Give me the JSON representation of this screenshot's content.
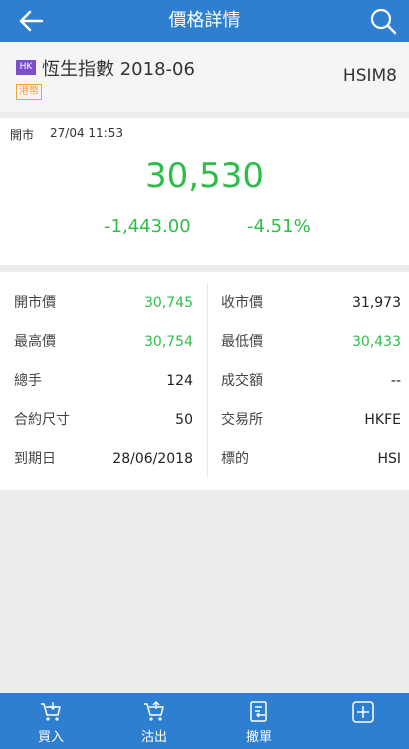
{
  "header": {
    "title": "價格詳情",
    "back_icon": "arrow-left-icon",
    "search_icon": "search-icon"
  },
  "instrument": {
    "market_badge": "HK",
    "name": "恆生指數 2018-06",
    "currency_badge": "港幣",
    "code": "HSIM8"
  },
  "quote": {
    "status": "開市",
    "time": "27/04 11:53",
    "last": "30,530",
    "change": "-1,443.00",
    "change_pct": "-4.51%",
    "up_color": "#2fbd4a"
  },
  "details": [
    {
      "left_label": "開市價",
      "left_value": "30,745",
      "right_label": "收市價",
      "right_value": "31,973"
    },
    {
      "left_label": "最高價",
      "left_value": "30,754",
      "right_label": "最低價",
      "right_value": "30,433"
    },
    {
      "left_label": "總手",
      "left_value": "124",
      "right_label": "成交額",
      "right_value": "--"
    },
    {
      "left_label": "合約尺寸",
      "left_value": "50",
      "right_label": "交易所",
      "right_value": "HKFE"
    },
    {
      "left_label": "到期日",
      "left_value": "28/06/2018",
      "right_label": "標的",
      "right_value": "HSI"
    }
  ],
  "bottom_nav": [
    {
      "label": "買入",
      "icon": "cart-in-icon"
    },
    {
      "label": "沽出",
      "icon": "cart-out-icon"
    },
    {
      "label": "撤單",
      "icon": "cancel-order-icon"
    },
    {
      "label": "",
      "icon": "plus-box-icon"
    }
  ]
}
